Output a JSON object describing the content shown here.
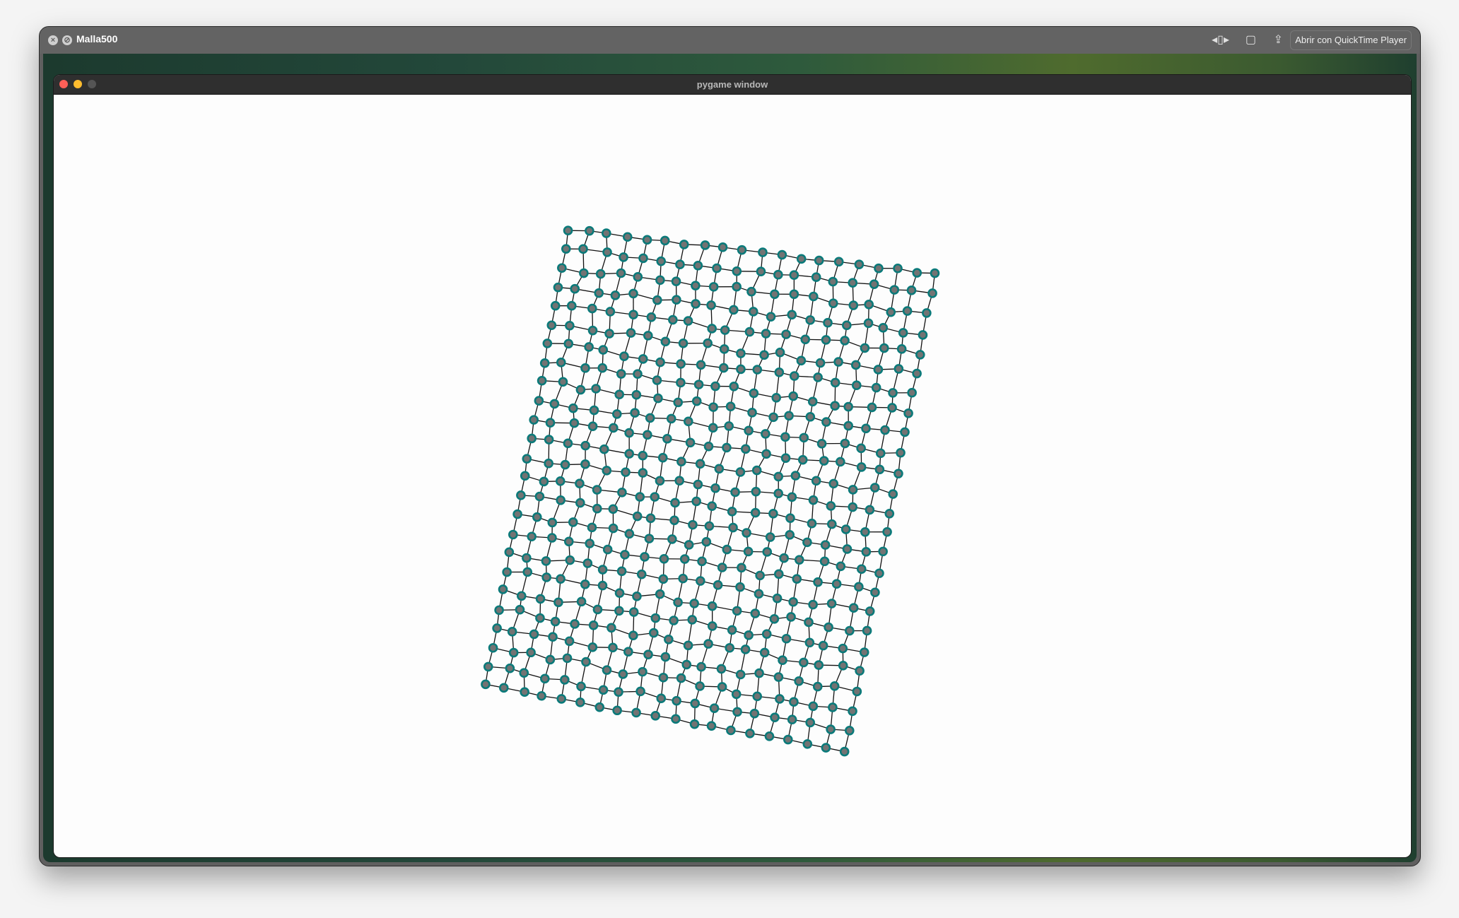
{
  "player": {
    "title": "Malla500",
    "open_button": "Abrir con QuickTime Player",
    "icons": [
      "close-icon",
      "no-entry-icon",
      "trim-icon",
      "rotate-icon",
      "share-icon"
    ]
  },
  "pygame": {
    "title": "pygame window",
    "lights": {
      "close": "#fe5f57",
      "minimize": "#febc2e",
      "zoom": "#555555"
    }
  },
  "mesh": {
    "columns": 20,
    "rows": 25,
    "node_fill": "#737373",
    "node_ring": "#0b7a7a",
    "edge_color": "#111111"
  }
}
